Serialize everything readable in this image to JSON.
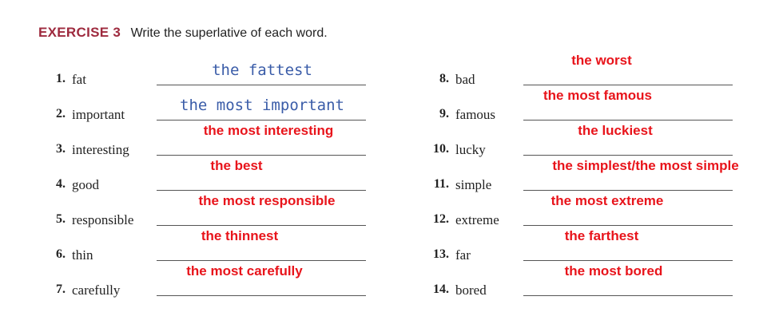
{
  "exercise": {
    "label": "EXERCISE 3",
    "instruction": "Write the superlative of each word."
  },
  "colors": {
    "exercise_label": "#9e2a3e",
    "handwritten_answer": "#3a5ca8",
    "typed_answer": "#e8141b"
  },
  "items": [
    {
      "num": "1.",
      "word": "fat",
      "answer": "the fattest",
      "style": "hand"
    },
    {
      "num": "2.",
      "word": "important",
      "answer": "the most important",
      "style": "hand"
    },
    {
      "num": "3.",
      "word": "interesting",
      "answer": "the most interesting",
      "style": "typed"
    },
    {
      "num": "4.",
      "word": "good",
      "answer": "the best",
      "style": "typed"
    },
    {
      "num": "5.",
      "word": "responsible",
      "answer": "the most responsible",
      "style": "typed"
    },
    {
      "num": "6.",
      "word": "thin",
      "answer": "the thinnest",
      "style": "typed"
    },
    {
      "num": "7.",
      "word": "carefully",
      "answer": "the most carefully",
      "style": "typed"
    },
    {
      "num": "8.",
      "word": "bad",
      "answer": "the worst",
      "style": "typed"
    },
    {
      "num": "9.",
      "word": "famous",
      "answer": "the most famous",
      "style": "typed"
    },
    {
      "num": "10.",
      "word": "lucky",
      "answer": "the luckiest",
      "style": "typed"
    },
    {
      "num": "11.",
      "word": "simple",
      "answer": "the simplest/the most simple",
      "style": "typed"
    },
    {
      "num": "12.",
      "word": "extreme",
      "answer": "the most extreme",
      "style": "typed"
    },
    {
      "num": "13.",
      "word": "far",
      "answer": "the farthest",
      "style": "typed"
    },
    {
      "num": "14.",
      "word": "bored",
      "answer": "the most bored",
      "style": "typed"
    }
  ]
}
